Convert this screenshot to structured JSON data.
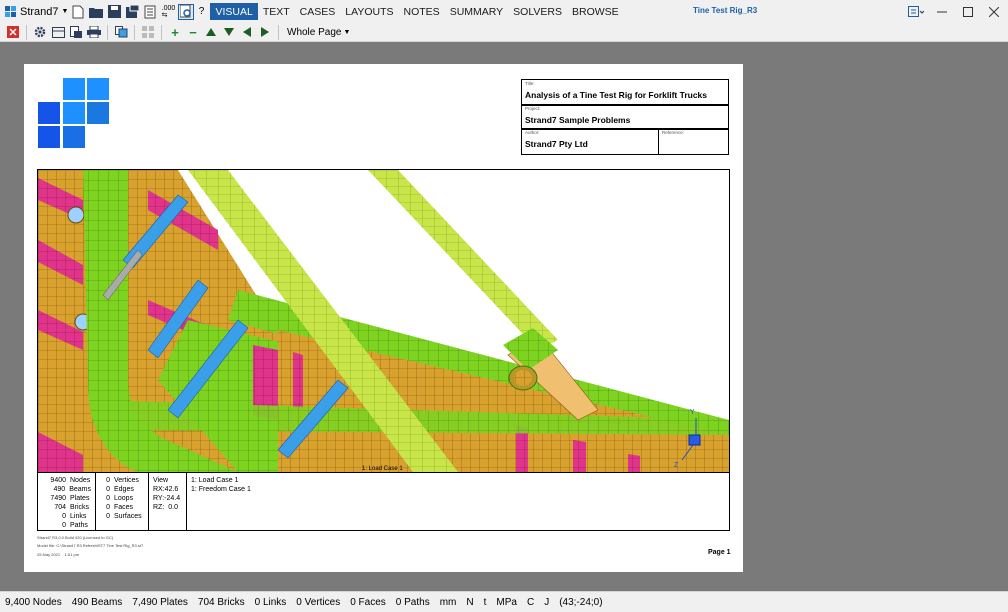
{
  "app": {
    "name": "Strand7",
    "window_title": "Tine Test Rig_R3"
  },
  "menus": [
    {
      "label": "VISUAL",
      "active": true
    },
    {
      "label": "TEXT"
    },
    {
      "label": "CASES"
    },
    {
      "label": "LAYOUTS"
    },
    {
      "label": "NOTES"
    },
    {
      "label": "SUMMARY"
    },
    {
      "label": "SOLVERS"
    },
    {
      "label": "BROWSE"
    }
  ],
  "toolbar": {
    "zoom_value": "Whole Page"
  },
  "page": {
    "title_caption": "Title:",
    "title": "Analysis of a Tine Test Rig for Forklift Trucks",
    "project_caption": "Project:",
    "project": "Strand7 Sample Problems",
    "author_caption": "Author:",
    "author": "Strand7 Pty Ltd",
    "reference_caption": "Reference:",
    "viewport_label": "1: Load Case 1",
    "axis": {
      "y": "Y",
      "z": "Z"
    },
    "stats": {
      "counts": [
        {
          "value": "9400",
          "label": "Nodes"
        },
        {
          "value": "490",
          "label": "Beams"
        },
        {
          "value": "7490",
          "label": "Plates"
        },
        {
          "value": "704",
          "label": "Bricks"
        },
        {
          "value": "0",
          "label": "Links"
        },
        {
          "value": "0",
          "label": "Paths"
        }
      ],
      "geometry": [
        {
          "value": "0",
          "label": "Vertices"
        },
        {
          "value": "0",
          "label": "Edges"
        },
        {
          "value": "0",
          "label": "Loops"
        },
        {
          "value": "0",
          "label": "Faces"
        },
        {
          "value": "0",
          "label": "Surfaces"
        }
      ],
      "view": {
        "heading": "View",
        "rows": [
          {
            "label": "RX:",
            "value": "42.6"
          },
          {
            "label": "RY:",
            "value": "-24.4"
          },
          {
            "label": "RZ:",
            "value": "0.0"
          }
        ]
      },
      "cases": [
        "1: Load Case 1",
        "1: Freedom Case 1"
      ]
    },
    "footer_build": "Strand7 R3.0.0 Build 420 (Licensed to GC)",
    "footer_file": "Model file: C:\\Strand7 R3 Refresh\\ST7 Tine Test Rig_R3.st7",
    "footer_date": "25 May 2021",
    "footer_time": "1:51 pm",
    "page_label": "Page 1"
  },
  "statusbar": [
    "9,400 Nodes",
    "490 Beams",
    "7,490 Plates",
    "704 Bricks",
    "0 Links",
    "0 Vertices",
    "0 Faces",
    "0 Paths",
    "mm",
    "N",
    "t",
    "MPa",
    "C",
    "J",
    "(43;-24;0)"
  ],
  "colors": {
    "accent": "#1f5fa6",
    "plate_green": "#7ed321",
    "plate_orange": "#d9a22e",
    "plate_magenta": "#e0338a",
    "beam_blue": "#3a9ee8"
  }
}
